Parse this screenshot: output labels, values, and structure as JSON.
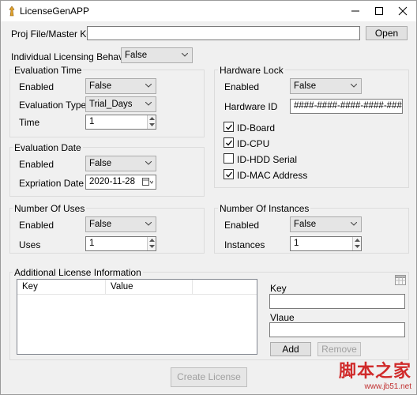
{
  "window": {
    "title": "LicenseGenAPP"
  },
  "proj": {
    "label": "Proj File/Master Key",
    "value": "",
    "open_label": "Open"
  },
  "individual": {
    "label": "Individual Licensing Behaviour",
    "value": "False"
  },
  "evaluation_time": {
    "title": "Evaluation Time",
    "enabled_label": "Enabled",
    "enabled_value": "False",
    "type_label": "Evaluation Type",
    "type_value": "Trial_Days",
    "time_label": "Time",
    "time_value": "1"
  },
  "evaluation_date": {
    "title": "Evaluation Date",
    "enabled_label": "Enabled",
    "enabled_value": "False",
    "expiration_label": "Expriation Date",
    "expiration_value": "2020-11-28"
  },
  "number_of_uses": {
    "title": "Number Of Uses",
    "enabled_label": "Enabled",
    "enabled_value": "False",
    "uses_label": "Uses",
    "uses_value": "1"
  },
  "hardware_lock": {
    "title": "Hardware Lock",
    "enabled_label": "Enabled",
    "enabled_value": "False",
    "hwid_label": "Hardware ID",
    "hwid_value": "####-####-####-####-####",
    "checks": [
      {
        "label": "ID-Board",
        "checked": true
      },
      {
        "label": "ID-CPU",
        "checked": true
      },
      {
        "label": "ID-HDD Serial",
        "checked": false
      },
      {
        "label": "ID-MAC Address",
        "checked": true
      }
    ]
  },
  "number_of_instances": {
    "title": "Number Of Instances",
    "enabled_label": "Enabled",
    "enabled_value": "False",
    "instances_label": "Instances",
    "instances_value": "1"
  },
  "additional": {
    "title": "Additional License Information",
    "columns": [
      "Key",
      "Value"
    ],
    "key_label": "Key",
    "key_value": "",
    "value_label": "Vlaue",
    "value_value": "",
    "add_label": "Add",
    "remove_label": "Remove"
  },
  "create_label": "Create License",
  "watermark": {
    "main": "脚本之家",
    "sub": "www.jb51.net"
  },
  "colors": {
    "accent": "#0078d7",
    "watermark": "#d02a2a"
  },
  "icons": {
    "app": "app-icon",
    "calendar": "calendar-icon",
    "table": "table-icon"
  }
}
